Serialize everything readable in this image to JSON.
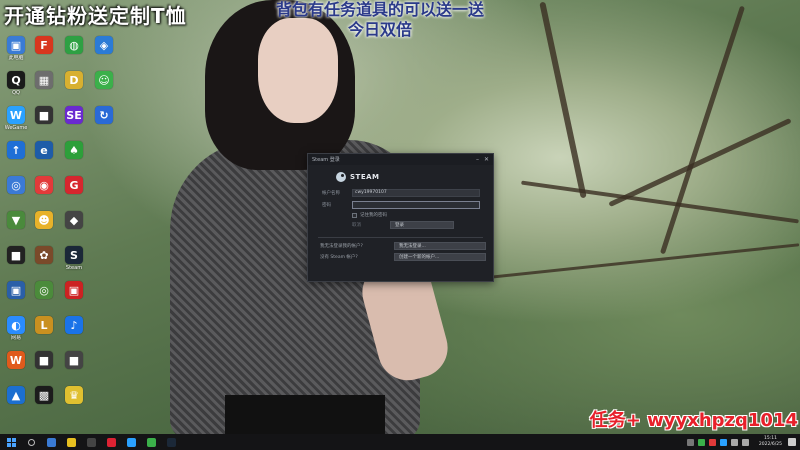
{
  "overlay": {
    "top_left": "开通钻粉送定制T恤",
    "top_center_line1": "背包有任务道具的可以送一送",
    "top_center_line2": "今日双倍",
    "task_text": "任务+ wyyxhpzq1014"
  },
  "desktop_icons": [
    {
      "label": "此电脑",
      "color": "#3a7bd5",
      "glyph": "▣"
    },
    {
      "label": "QQ",
      "color": "#1a1a1a",
      "glyph": "Q"
    },
    {
      "label": "WeGame",
      "color": "#2aa1ff",
      "glyph": "W"
    },
    {
      "label": "",
      "color": "#1f6fd6",
      "glyph": "↑"
    },
    {
      "label": "",
      "color": "#3b7ad6",
      "glyph": "◎"
    },
    {
      "label": "",
      "color": "#4a8a3c",
      "glyph": "▼"
    },
    {
      "label": "",
      "color": "#222",
      "glyph": "■"
    },
    {
      "label": "",
      "color": "#2a5fa8",
      "glyph": "▣"
    },
    {
      "label": "网易",
      "color": "#2a8cff",
      "glyph": "◐"
    },
    {
      "label": "",
      "color": "#e05a1c",
      "glyph": "W"
    },
    {
      "label": "",
      "color": "#1c6fd0",
      "glyph": "▲"
    },
    {
      "label": "",
      "color": "#d8361e",
      "glyph": "F"
    },
    {
      "label": "",
      "color": "#6d6d6d",
      "glyph": "▦"
    },
    {
      "label": "",
      "color": "#333",
      "glyph": "■"
    },
    {
      "label": "",
      "color": "#1e5ca8",
      "glyph": "e"
    },
    {
      "label": "",
      "color": "#e23a3a",
      "glyph": "◉"
    },
    {
      "label": "",
      "color": "#e8b22a",
      "glyph": "☻"
    },
    {
      "label": "",
      "color": "#7a4a2a",
      "glyph": "✿"
    },
    {
      "label": "",
      "color": "#4b8b3b",
      "glyph": "◎"
    },
    {
      "label": "",
      "color": "#c99020",
      "glyph": "L"
    },
    {
      "label": "",
      "color": "#333",
      "glyph": "■"
    },
    {
      "label": "",
      "color": "#1c1c1c",
      "glyph": "▩"
    },
    {
      "label": "",
      "color": "#2ea043",
      "glyph": "◍"
    },
    {
      "label": "",
      "color": "#d8b030",
      "glyph": "D"
    },
    {
      "label": "",
      "color": "#6a2ad0",
      "glyph": "SE"
    },
    {
      "label": "",
      "color": "#2d9f3a",
      "glyph": "♠"
    },
    {
      "label": "",
      "color": "#d6262e",
      "glyph": "G"
    },
    {
      "label": "",
      "color": "#444",
      "glyph": "◆"
    },
    {
      "label": "Steam",
      "color": "#1b2838",
      "glyph": "S"
    },
    {
      "label": "",
      "color": "#c22",
      "glyph": "▣"
    },
    {
      "label": "",
      "color": "#1a73e8",
      "glyph": "♪"
    },
    {
      "label": "",
      "color": "#444",
      "glyph": "■"
    },
    {
      "label": "",
      "color": "#e0c030",
      "glyph": "♛"
    },
    {
      "label": "",
      "color": "#2b7bd6",
      "glyph": "◈"
    },
    {
      "label": "",
      "color": "#3bb04a",
      "glyph": "☺"
    },
    {
      "label": "",
      "color": "#2a6ad6",
      "glyph": "↻"
    }
  ],
  "steam_window": {
    "title": "Steam 登录",
    "logo_text": "STEAM",
    "account_label": "帐户名称",
    "account_value": "cwy19970107",
    "password_label": "密码",
    "password_value": "",
    "remember_label": "记住我的密码",
    "cancel_label": "取消",
    "login_button": "登录",
    "forgot_label": "我无法登录我的帐户?",
    "forgot_button": "我无法登录...",
    "new_account_label": "没有 Steam 帐户?",
    "new_account_button": "创建一个新的帐户..."
  },
  "taskbar": {
    "time": "15:11",
    "date": "2022/6/25",
    "pinned_colors": [
      "#3a7bd5",
      "#e8c020",
      "#444",
      "#d23",
      "#2aa1ff",
      "#3bb04a",
      "#1b2838"
    ]
  }
}
